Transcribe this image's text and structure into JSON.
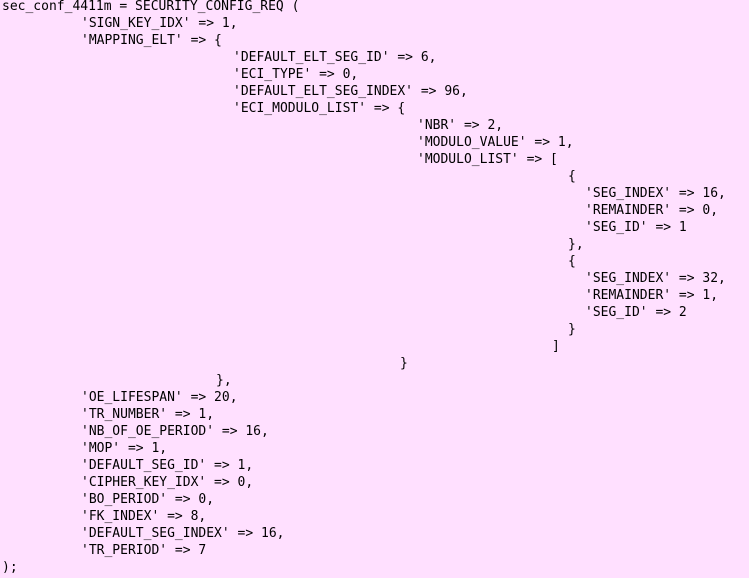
{
  "colors": {
    "background": "#ffe0ff",
    "text": "#000000"
  },
  "code": {
    "lines": [
      "sec_conf_4411m = SECURITY_CONFIG_REQ (",
      "'SIGN_KEY_IDX' => 1,",
      "'MAPPING_ELT' => {",
      "'DEFAULT_ELT_SEG_ID' => 6,",
      "'ECI_TYPE' => 0,",
      "'DEFAULT_ELT_SEG_INDEX' => 96,",
      "'ECI_MODULO_LIST' => {",
      "'NBR' => 2,",
      "'MODULO_VALUE' => 1,",
      "'MODULO_LIST' => [",
      "{",
      "'SEG_INDEX' => 16,",
      "'REMAINDER' => 0,",
      "'SEG_ID' => 1",
      "},",
      "{",
      "'SEG_INDEX' => 32,",
      "'REMAINDER' => 1,",
      "'SEG_ID' => 2",
      "}",
      "]",
      "}",
      "},",
      "'OE_LIFESPAN' => 20,",
      "'TR_NUMBER' => 1,",
      "'NB_OF_OE_PERIOD' => 16,",
      "'MOP' => 1,",
      "'DEFAULT_SEG_ID' => 1,",
      "'CIPHER_KEY_IDX' => 0,",
      "'BO_PERIOD' => 0,",
      "'FK_INDEX' => 8,",
      "'DEFAULT_SEG_INDEX' => 16,",
      "'TR_PERIOD' => 7",
      ");"
    ]
  }
}
